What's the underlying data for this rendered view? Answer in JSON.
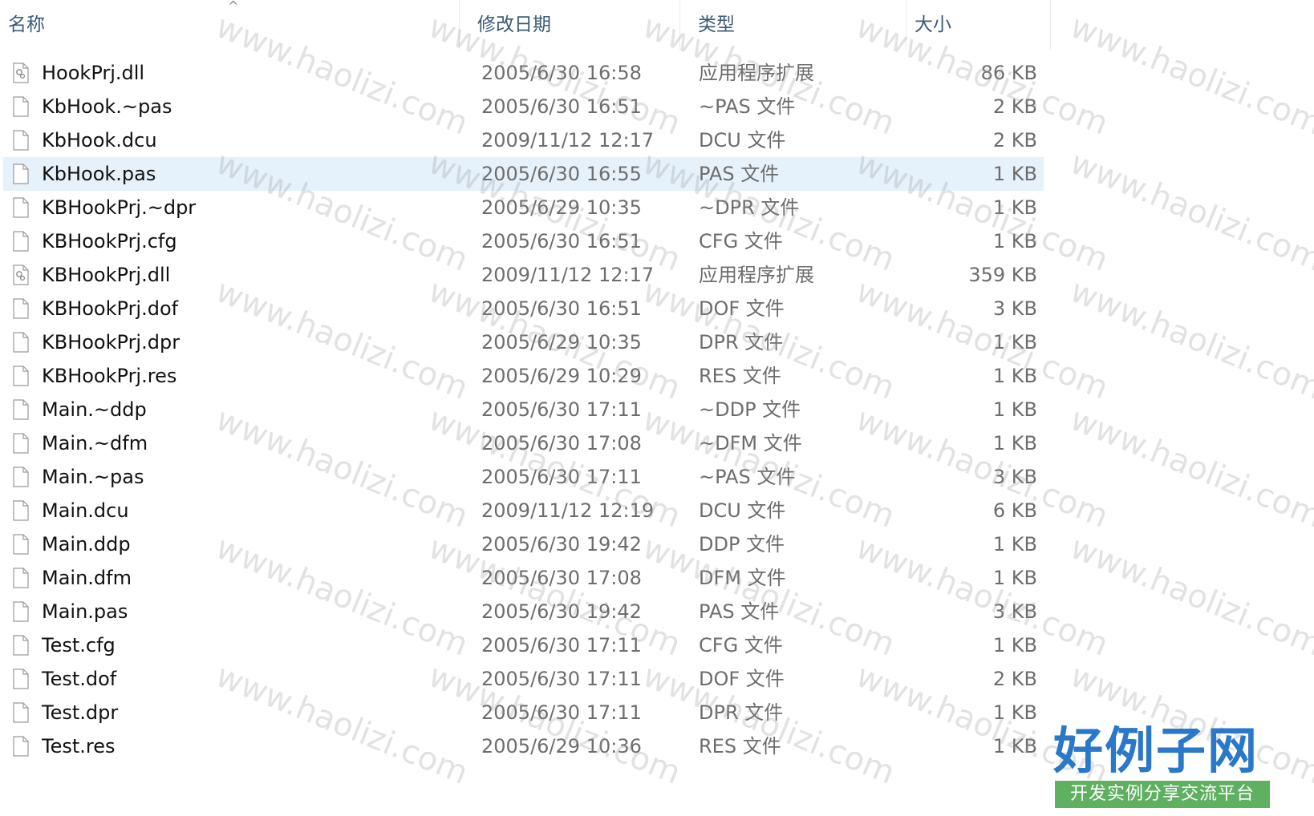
{
  "header": {
    "name_label": "名称",
    "date_label": "修改日期",
    "type_label": "类型",
    "size_label": "大小",
    "sort_indicator": "^"
  },
  "files": [
    {
      "name": "HookPrj.dll",
      "date": "2005/6/30 16:58",
      "type": "应用程序扩展",
      "size": "86 KB",
      "icon": "dll-gear-icon"
    },
    {
      "name": "KbHook.~pas",
      "date": "2005/6/30 16:51",
      "type": "~PAS 文件",
      "size": "2 KB",
      "icon": "file-icon"
    },
    {
      "name": "KbHook.dcu",
      "date": "2009/11/12 12:17",
      "type": "DCU 文件",
      "size": "2 KB",
      "icon": "file-icon"
    },
    {
      "name": "KbHook.pas",
      "date": "2005/6/30 16:55",
      "type": "PAS 文件",
      "size": "1 KB",
      "icon": "file-icon",
      "selected": true
    },
    {
      "name": "KBHookPrj.~dpr",
      "date": "2005/6/29 10:35",
      "type": "~DPR 文件",
      "size": "1 KB",
      "icon": "file-icon"
    },
    {
      "name": "KBHookPrj.cfg",
      "date": "2005/6/30 16:51",
      "type": "CFG 文件",
      "size": "1 KB",
      "icon": "file-icon"
    },
    {
      "name": "KBHookPrj.dll",
      "date": "2009/11/12 12:17",
      "type": "应用程序扩展",
      "size": "359 KB",
      "icon": "dll-gear-icon"
    },
    {
      "name": "KBHookPrj.dof",
      "date": "2005/6/30 16:51",
      "type": "DOF 文件",
      "size": "3 KB",
      "icon": "file-icon"
    },
    {
      "name": "KBHookPrj.dpr",
      "date": "2005/6/29 10:35",
      "type": "DPR 文件",
      "size": "1 KB",
      "icon": "file-icon"
    },
    {
      "name": "KBHookPrj.res",
      "date": "2005/6/29 10:29",
      "type": "RES 文件",
      "size": "1 KB",
      "icon": "file-icon"
    },
    {
      "name": "Main.~ddp",
      "date": "2005/6/30 17:11",
      "type": "~DDP 文件",
      "size": "1 KB",
      "icon": "file-icon"
    },
    {
      "name": "Main.~dfm",
      "date": "2005/6/30 17:08",
      "type": "~DFM 文件",
      "size": "1 KB",
      "icon": "file-icon"
    },
    {
      "name": "Main.~pas",
      "date": "2005/6/30 17:11",
      "type": "~PAS 文件",
      "size": "3 KB",
      "icon": "file-icon"
    },
    {
      "name": "Main.dcu",
      "date": "2009/11/12 12:19",
      "type": "DCU 文件",
      "size": "6 KB",
      "icon": "file-icon"
    },
    {
      "name": "Main.ddp",
      "date": "2005/6/30 19:42",
      "type": "DDP 文件",
      "size": "1 KB",
      "icon": "file-icon"
    },
    {
      "name": "Main.dfm",
      "date": "2005/6/30 17:08",
      "type": "DFM 文件",
      "size": "1 KB",
      "icon": "file-icon"
    },
    {
      "name": "Main.pas",
      "date": "2005/6/30 19:42",
      "type": "PAS 文件",
      "size": "3 KB",
      "icon": "file-icon"
    },
    {
      "name": "Test.cfg",
      "date": "2005/6/30 17:11",
      "type": "CFG 文件",
      "size": "1 KB",
      "icon": "file-icon"
    },
    {
      "name": "Test.dof",
      "date": "2005/6/30 17:11",
      "type": "DOF 文件",
      "size": "2 KB",
      "icon": "file-icon"
    },
    {
      "name": "Test.dpr",
      "date": "2005/6/30 17:11",
      "type": "DPR 文件",
      "size": "1 KB",
      "icon": "file-icon"
    },
    {
      "name": "Test.res",
      "date": "2005/6/29 10:36",
      "type": "RES 文件",
      "size": "1 KB",
      "icon": "file-icon"
    }
  ],
  "watermark_text": "www.haolizi.com",
  "brand": {
    "title": "好例子网",
    "subtitle": "开发实例分享交流平台"
  },
  "colors": {
    "header_text": "#3c5a7a",
    "selected_row": "#e5f1fb",
    "brand_blue": "#2a78c8",
    "brand_green": "#5fb060"
  }
}
